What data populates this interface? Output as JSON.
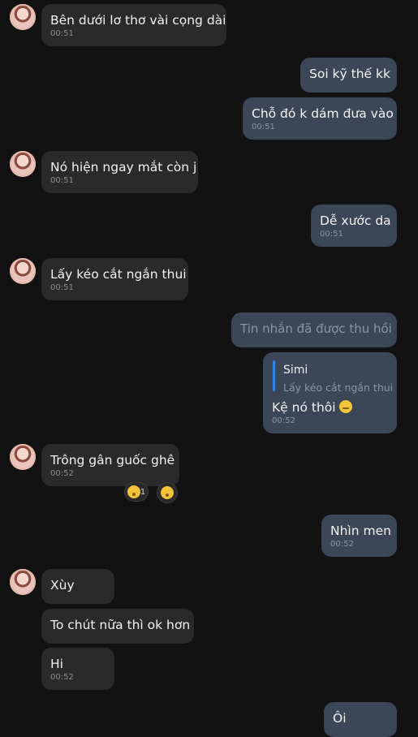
{
  "messages": [
    {
      "id": "m1",
      "text": "Bên dưới lơ thơ vài cọng dài",
      "time": "00:51"
    },
    {
      "id": "m2",
      "text": "Soi kỹ thế kk"
    },
    {
      "id": "m3",
      "text": "Chỗ đó k dám đưa vào",
      "time": "00:51"
    },
    {
      "id": "m4",
      "text": "Nó hiện ngay mắt còn j",
      "time": "00:51"
    },
    {
      "id": "m5",
      "text": "Dễ xước da",
      "time": "00:51"
    },
    {
      "id": "m6",
      "text": "Lấy kéo cắt ngắn thui",
      "time": "00:51"
    },
    {
      "id": "m7",
      "text": "Tin nhắn đã được thu hồi"
    },
    {
      "id": "m8",
      "reply_name": "Simi",
      "reply_text": "Lấy kéo cắt ngắn thui",
      "text": "Kệ nó thôi",
      "time": "00:52"
    },
    {
      "id": "m9",
      "text": "Trông gân guốc ghê",
      "time": "00:52",
      "reaction_count": "1"
    },
    {
      "id": "m10",
      "text": "Nhìn men",
      "time": "00:52"
    },
    {
      "id": "m11",
      "text": "Xùy"
    },
    {
      "id": "m12",
      "text": "To chút nữa thì ok hơn"
    },
    {
      "id": "m13",
      "text": "Hi",
      "time": "00:52"
    },
    {
      "id": "m14",
      "text": "Ôi"
    }
  ]
}
